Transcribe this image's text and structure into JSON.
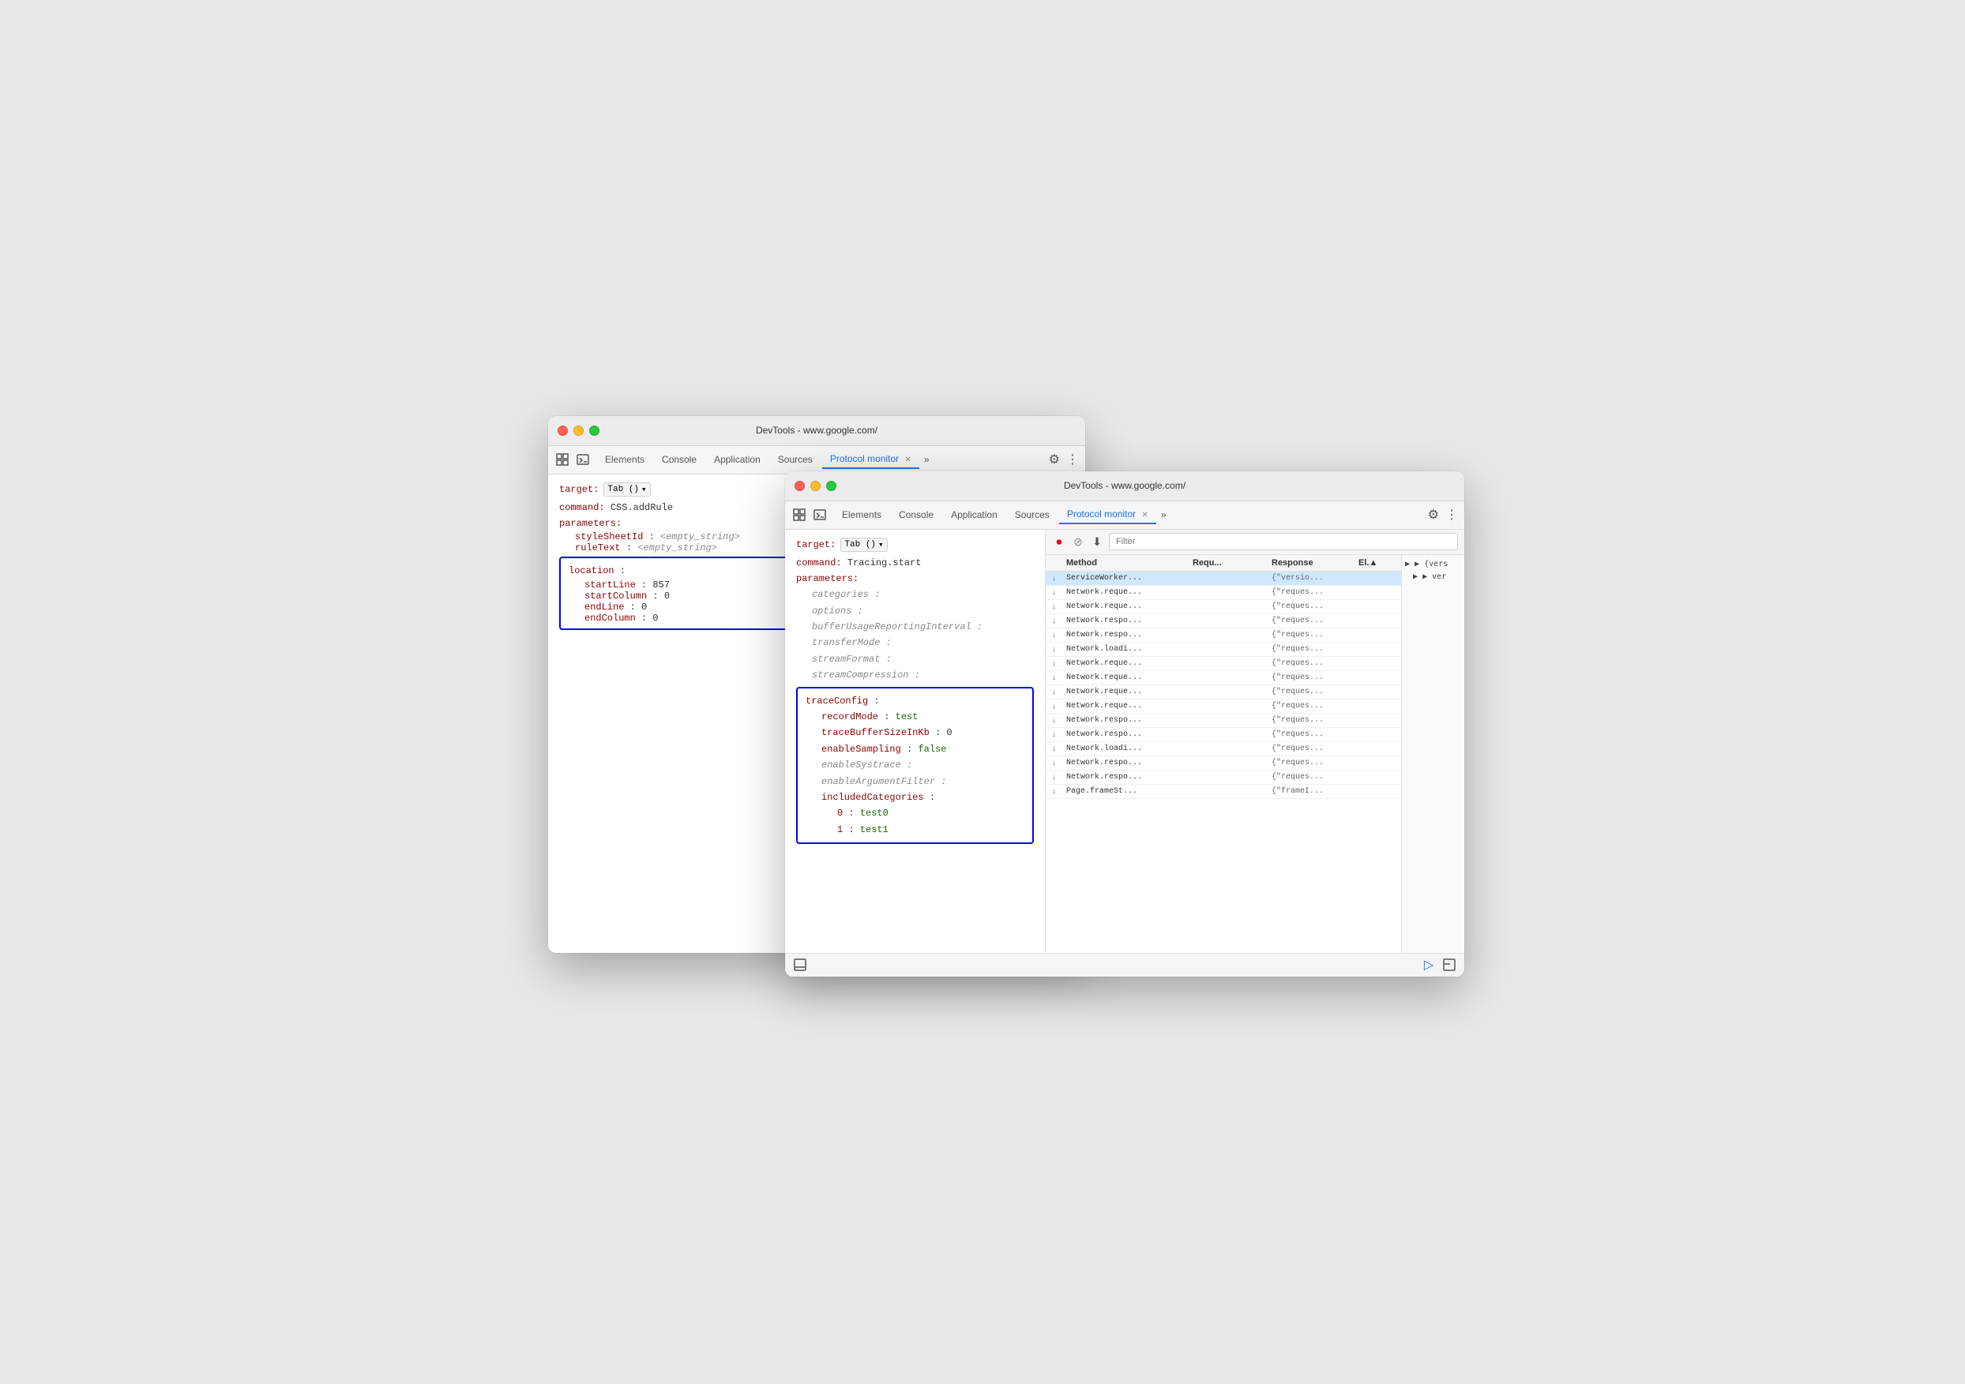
{
  "scene": {
    "background": "#e8e8e8"
  },
  "window_back": {
    "title": "DevTools - www.google.com/",
    "tabs": [
      {
        "label": "Elements",
        "active": false
      },
      {
        "label": "Console",
        "active": false
      },
      {
        "label": "Application",
        "active": false
      },
      {
        "label": "Sources",
        "active": false
      },
      {
        "label": "Protocol monitor",
        "active": true
      }
    ],
    "target_label": "target:",
    "target_value": "Tab ()",
    "command_label": "command:",
    "command_value": "CSS.addRule",
    "parameters_label": "parameters:",
    "fields": [
      {
        "key": "styleSheetId",
        "value": "<empty_string>",
        "indent": 1,
        "empty": true
      },
      {
        "key": "ruleText",
        "value": "<empty_string>",
        "indent": 1,
        "empty": true
      }
    ],
    "location_box": {
      "key": "location",
      "fields": [
        {
          "key": "startLine",
          "value": "857"
        },
        {
          "key": "startColumn",
          "value": "0"
        },
        {
          "key": "endLine",
          "value": "0"
        },
        {
          "key": "endColumn",
          "value": "0"
        }
      ]
    }
  },
  "window_front": {
    "title": "DevTools - www.google.com/",
    "tabs": [
      {
        "label": "Elements",
        "active": false
      },
      {
        "label": "Console",
        "active": false
      },
      {
        "label": "Application",
        "active": false
      },
      {
        "label": "Sources",
        "active": false
      },
      {
        "label": "Protocol monitor",
        "active": true
      }
    ],
    "target_label": "target:",
    "target_value": "Tab ()",
    "command_label": "command:",
    "command_value": "Tracing.start",
    "parameters_label": "parameters:",
    "param_fields": [
      {
        "key": "categories",
        "indent": 1
      },
      {
        "key": "options",
        "indent": 1
      },
      {
        "key": "bufferUsageReportingInterval",
        "indent": 1
      },
      {
        "key": "transferMode",
        "indent": 1
      },
      {
        "key": "streamFormat",
        "indent": 1
      },
      {
        "key": "streamCompression",
        "indent": 1
      }
    ],
    "trace_config_box": {
      "key": "traceConfig",
      "fields": [
        {
          "key": "recordMode",
          "value": "test"
        },
        {
          "key": "traceBufferSizeInKb",
          "value": "0"
        },
        {
          "key": "enableSampling",
          "value": "false"
        },
        {
          "key": "enableSystrace"
        },
        {
          "key": "enableArgumentFilter"
        },
        {
          "key": "includedCategories",
          "children": [
            {
              "key": "0",
              "value": "test0"
            },
            {
              "key": "1",
              "value": "test1"
            }
          ]
        }
      ]
    },
    "filter_placeholder": "Filter",
    "table": {
      "headers": [
        "",
        "Method",
        "Requ...",
        "Response",
        "El...",
        ""
      ],
      "rows": [
        {
          "arrow": "↓",
          "method": "ServiceWorker...",
          "request": "",
          "response": "{\"versio...",
          "selected": true
        },
        {
          "arrow": "↓",
          "method": "Network.reque...",
          "request": "",
          "response": "{\"reques..."
        },
        {
          "arrow": "↓",
          "method": "Network.reque...",
          "request": "",
          "response": "{\"reques..."
        },
        {
          "arrow": "↓",
          "method": "Network.respo...",
          "request": "",
          "response": "{\"reques..."
        },
        {
          "arrow": "↓",
          "method": "Network.respo...",
          "request": "",
          "response": "{\"reques..."
        },
        {
          "arrow": "↓",
          "method": "Network.loadi...",
          "request": "",
          "response": "{\"reques..."
        },
        {
          "arrow": "↓",
          "method": "Network.reque...",
          "request": "",
          "response": "{\"reques..."
        },
        {
          "arrow": "↓",
          "method": "Network.reque...",
          "request": "",
          "response": "{\"reques..."
        },
        {
          "arrow": "↓",
          "method": "Network.reque...",
          "request": "",
          "response": "{\"reques..."
        },
        {
          "arrow": "↓",
          "method": "Network.reque...",
          "request": "",
          "response": "{\"reques..."
        },
        {
          "arrow": "↓",
          "method": "Network.respo...",
          "request": "",
          "response": "{\"reques..."
        },
        {
          "arrow": "↓",
          "method": "Network.respo...",
          "request": "",
          "response": "{\"reques..."
        },
        {
          "arrow": "↓",
          "method": "Network.loadi...",
          "request": "",
          "response": "{\"reques..."
        },
        {
          "arrow": "↓",
          "method": "Network.respo...",
          "request": "",
          "response": "{\"reques..."
        },
        {
          "arrow": "↓",
          "method": "Network.respo...",
          "request": "",
          "response": "{\"reques..."
        },
        {
          "arrow": "↓",
          "method": "Page.frameSt...",
          "request": "",
          "response": "{\"frameI..."
        }
      ]
    },
    "json_preview": {
      "line1": "▶ {vers",
      "line2": "  ▶ ver"
    }
  }
}
